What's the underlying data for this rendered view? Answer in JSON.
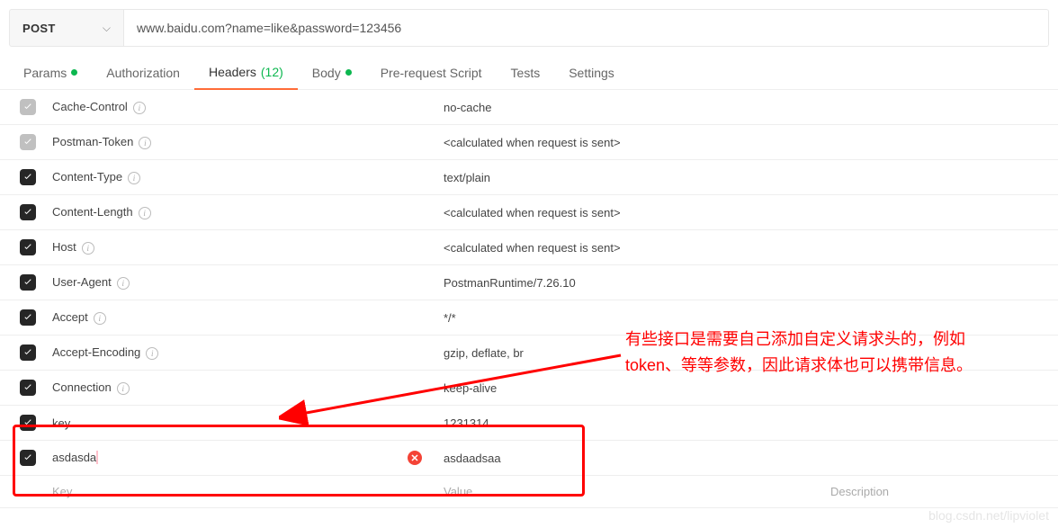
{
  "method": "POST",
  "url": "www.baidu.com?name=like&password=123456",
  "tabs": {
    "params": {
      "label": "Params"
    },
    "authorization": {
      "label": "Authorization"
    },
    "headers": {
      "label": "Headers",
      "count": "(12)"
    },
    "body": {
      "label": "Body"
    },
    "prerequest": {
      "label": "Pre-request Script"
    },
    "tests": {
      "label": "Tests"
    },
    "settings": {
      "label": "Settings"
    }
  },
  "headers": [
    {
      "checked": "gray",
      "key": "Cache-Control",
      "value": "no-cache",
      "info": true
    },
    {
      "checked": "gray",
      "key": "Postman-Token",
      "value": "<calculated when request is sent>",
      "info": true
    },
    {
      "checked": "black",
      "key": "Content-Type",
      "value": "text/plain",
      "info": true
    },
    {
      "checked": "black",
      "key": "Content-Length",
      "value": "<calculated when request is sent>",
      "info": true
    },
    {
      "checked": "black",
      "key": "Host",
      "value": "<calculated when request is sent>",
      "info": true
    },
    {
      "checked": "black",
      "key": "User-Agent",
      "value": "PostmanRuntime/7.26.10",
      "info": true
    },
    {
      "checked": "black",
      "key": "Accept",
      "value": "*/*",
      "info": true
    },
    {
      "checked": "black",
      "key": "Accept-Encoding",
      "value": "gzip, deflate, br",
      "info": true
    },
    {
      "checked": "black",
      "key": "Connection",
      "value": "keep-alive",
      "info": true
    },
    {
      "checked": "black",
      "key": "key",
      "value": "1231314",
      "info": false
    },
    {
      "checked": "black",
      "key": "asdasda",
      "value": "asdaadsaa",
      "info": false,
      "delete": true,
      "caret": true
    }
  ],
  "placeholder": {
    "key": "Key",
    "value": "Value",
    "desc": "Description"
  },
  "annotation": "有些接口是需要自己添加自定义请求头的，例如token、等等参数，因此请求体也可以携带信息。",
  "watermark": "blog.csdn.net/lipviolet"
}
